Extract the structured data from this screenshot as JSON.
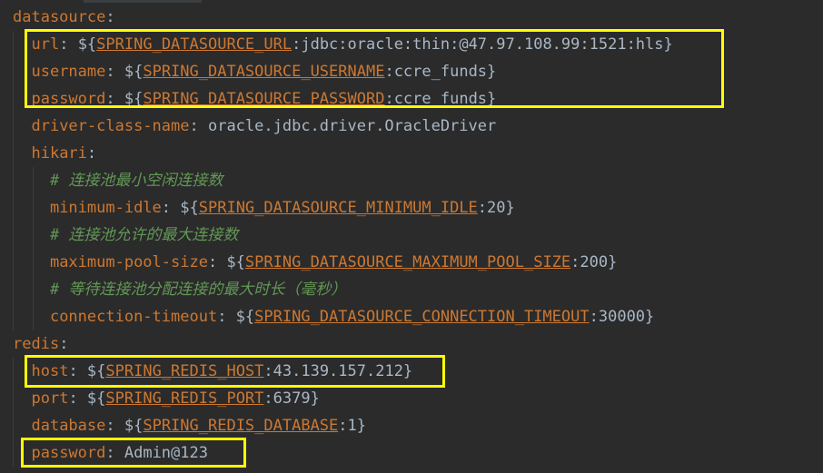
{
  "editor": {
    "lines": [
      {
        "indent": "",
        "key": "datasource",
        "sep": ":",
        "parts": []
      },
      {
        "indent": "  ",
        "key": "url",
        "sep": ": ",
        "parts": [
          {
            "t": "plain",
            "v": "${"
          },
          {
            "t": "ref",
            "v": "SPRING_DATASOURCE_URL"
          },
          {
            "t": "plain",
            "v": ":jdbc:oracle:thin:@47.97.108.99:1521:hls}"
          }
        ]
      },
      {
        "indent": "  ",
        "key": "username",
        "sep": ": ",
        "parts": [
          {
            "t": "plain",
            "v": "${"
          },
          {
            "t": "ref",
            "v": "SPRING_DATASOURCE_USERNAME"
          },
          {
            "t": "plain",
            "v": ":ccre_funds}"
          }
        ]
      },
      {
        "indent": "  ",
        "key": "password",
        "sep": ": ",
        "parts": [
          {
            "t": "plain",
            "v": "${"
          },
          {
            "t": "ref",
            "v": "SPRING_DATASOURCE_PASSWORD"
          },
          {
            "t": "plain",
            "v": ":ccre_funds}"
          }
        ]
      },
      {
        "indent": "  ",
        "key": "driver-class-name",
        "sep": ": ",
        "parts": [
          {
            "t": "plain",
            "v": "oracle.jdbc.driver.OracleDriver"
          }
        ]
      },
      {
        "indent": "  ",
        "key": "hikari",
        "sep": ":",
        "parts": []
      },
      {
        "indent": "    ",
        "key": "",
        "sep": "",
        "parts": [
          {
            "t": "cmt",
            "v": "# 连接池最小空闲连接数"
          }
        ]
      },
      {
        "indent": "    ",
        "key": "minimum-idle",
        "sep": ": ",
        "parts": [
          {
            "t": "plain",
            "v": "${"
          },
          {
            "t": "ref",
            "v": "SPRING_DATASOURCE_MINIMUM_IDLE"
          },
          {
            "t": "plain",
            "v": ":20}"
          }
        ]
      },
      {
        "indent": "    ",
        "key": "",
        "sep": "",
        "parts": [
          {
            "t": "cmt",
            "v": "# 连接池允许的最大连接数"
          }
        ]
      },
      {
        "indent": "    ",
        "key": "maximum-pool-size",
        "sep": ": ",
        "parts": [
          {
            "t": "plain",
            "v": "${"
          },
          {
            "t": "ref",
            "v": "SPRING_DATASOURCE_MAXIMUM_POOL_SIZE"
          },
          {
            "t": "plain",
            "v": ":200}"
          }
        ]
      },
      {
        "indent": "    ",
        "key": "",
        "sep": "",
        "parts": [
          {
            "t": "cmt",
            "v": "# 等待连接池分配连接的最大时长（毫秒）"
          }
        ]
      },
      {
        "indent": "    ",
        "key": "connection-timeout",
        "sep": ": ",
        "parts": [
          {
            "t": "plain",
            "v": "${"
          },
          {
            "t": "ref",
            "v": "SPRING_DATASOURCE_CONNECTION_TIMEOUT"
          },
          {
            "t": "plain",
            "v": ":30000}"
          }
        ]
      },
      {
        "indent": "",
        "key": "redis",
        "sep": ":",
        "parts": []
      },
      {
        "indent": "  ",
        "key": "host",
        "sep": ": ",
        "parts": [
          {
            "t": "plain",
            "v": "${"
          },
          {
            "t": "ref",
            "v": "SPRING_REDIS_HOST"
          },
          {
            "t": "plain",
            "v": ":43.139.157.212}"
          }
        ]
      },
      {
        "indent": "  ",
        "key": "port",
        "sep": ": ",
        "parts": [
          {
            "t": "plain",
            "v": "${"
          },
          {
            "t": "ref",
            "v": "SPRING_REDIS_PORT"
          },
          {
            "t": "plain",
            "v": ":6379}"
          }
        ]
      },
      {
        "indent": "  ",
        "key": "database",
        "sep": ": ",
        "parts": [
          {
            "t": "plain",
            "v": "${"
          },
          {
            "t": "ref",
            "v": "SPRING_REDIS_DATABASE"
          },
          {
            "t": "plain",
            "v": ":1}"
          }
        ]
      },
      {
        "indent": "  ",
        "key": "password",
        "sep": ": ",
        "parts": [
          {
            "t": "plain",
            "v": "Admin@123"
          }
        ]
      }
    ]
  },
  "colors": {
    "background": "#2b2b2b",
    "key": "#cc7832",
    "text": "#a9b7c6",
    "comment": "#629755",
    "highlight": "#ffff00"
  }
}
